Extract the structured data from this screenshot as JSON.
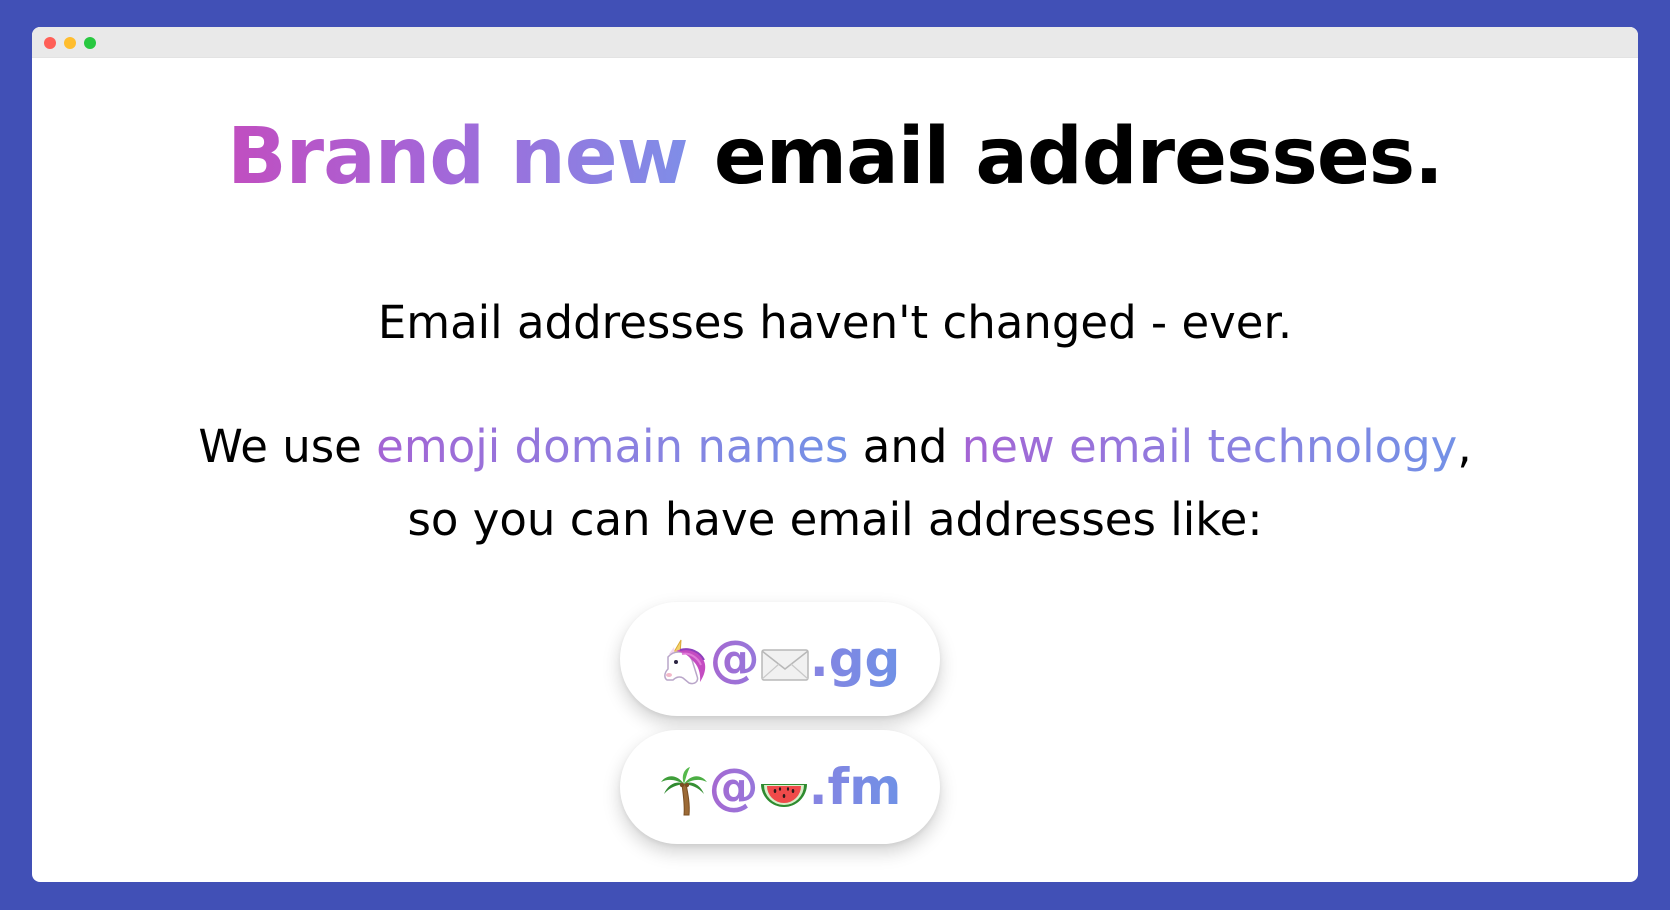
{
  "headline": {
    "accent_text": "Brand new",
    "rest_text": " email addresses."
  },
  "subtitle": "Email addresses haven't changed - ever.",
  "description": {
    "prefix": "We use ",
    "link1": "emoji domain names",
    "middle": " and ",
    "link2": "new email technology",
    "suffix": ", so you can have email addresses like:"
  },
  "examples": [
    {
      "local_icon": "unicorn-icon",
      "at": "@",
      "domain_icon": "envelope-icon",
      "tld": ".gg"
    },
    {
      "local_icon": "palm-tree-icon",
      "at": "@",
      "domain_icon": "watermelon-icon",
      "tld": ".fm"
    }
  ],
  "colors": {
    "background": "#4150b6",
    "window": "#ffffff",
    "title_bar": "#e9e9e9",
    "gradient_start": "#c14ec0",
    "gradient_end": "#7391e6",
    "text": "#000000"
  }
}
